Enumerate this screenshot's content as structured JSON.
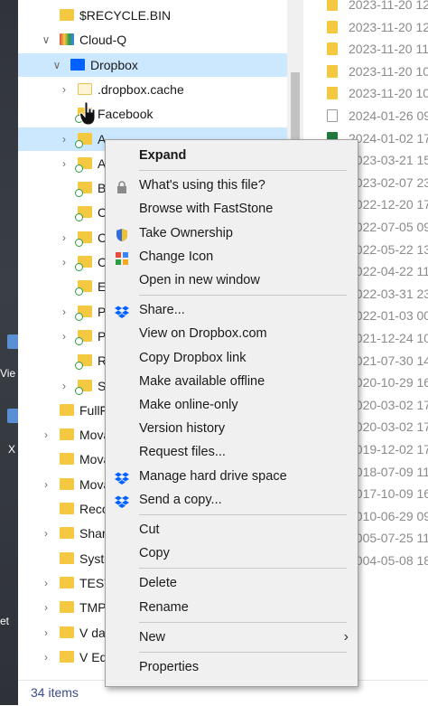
{
  "desktop": {
    "labels": [
      "Vie",
      "X",
      "et"
    ]
  },
  "tree": {
    "rows": [
      {
        "label": "$RECYCLE.BIN",
        "chev": "",
        "indent": 1
      },
      {
        "label": "Cloud-Q",
        "chev": "v",
        "indent": 1
      },
      {
        "label": "Dropbox",
        "chev": "v",
        "indent": 2
      },
      {
        "label": ".dropbox.cache",
        "chev": ">",
        "indent": 3
      },
      {
        "label": "Facebook",
        "chev": "",
        "indent": 3
      },
      {
        "label": "A",
        "chev": ">",
        "indent": 3
      },
      {
        "label": "A",
        "chev": ">",
        "indent": 3
      },
      {
        "label": "Ba",
        "chev": "",
        "indent": 3
      },
      {
        "label": "Ca",
        "chev": "",
        "indent": 3
      },
      {
        "label": "Ca",
        "chev": ">",
        "indent": 3
      },
      {
        "label": "Ca",
        "chev": ">",
        "indent": 3
      },
      {
        "label": "EV",
        "chev": "",
        "indent": 3
      },
      {
        "label": "PC",
        "chev": ">",
        "indent": 3
      },
      {
        "label": "Pr",
        "chev": ">",
        "indent": 3
      },
      {
        "label": "R-",
        "chev": "",
        "indent": 3
      },
      {
        "label": "So",
        "chev": ">",
        "indent": 3
      },
      {
        "label": "FullF",
        "chev": "",
        "indent": 1
      },
      {
        "label": "Mova",
        "chev": ">",
        "indent": 1
      },
      {
        "label": "Mova",
        "chev": "",
        "indent": 1
      },
      {
        "label": "Mova",
        "chev": ">",
        "indent": 1
      },
      {
        "label": "Reco",
        "chev": "",
        "indent": 1
      },
      {
        "label": "Share",
        "chev": ">",
        "indent": 1
      },
      {
        "label": "Syste",
        "chev": "",
        "indent": 1
      },
      {
        "label": "TEST",
        "chev": ">",
        "indent": 1
      },
      {
        "label": "TMP",
        "chev": ">",
        "indent": 1
      },
      {
        "label": "V da",
        "chev": ">",
        "indent": 1
      },
      {
        "label": "V Edi",
        "chev": ">",
        "indent": 1
      }
    ]
  },
  "details": {
    "dates": [
      "2023-11-20 12",
      "2023-11-20 12",
      "2023-11-20 11",
      "2023-11-20 10",
      "2023-11-20 10",
      "2024-01-26 09",
      "2024-01-02 17",
      "2023-03-21 15",
      "2023-02-07 23",
      "2022-12-20 17",
      "2022-07-05 09",
      "2022-05-22 13",
      "2022-04-22 11",
      "2022-03-31 23",
      "2022-01-03 00",
      "2021-12-24 10",
      "2021-07-30 14",
      "2020-10-29 16",
      "2020-03-02 17",
      "2020-03-02 17",
      "2019-12-02 17",
      "2018-07-09 11",
      "2017-10-09 16",
      "2010-06-29 09",
      "2005-07-25 11",
      "2004-05-08 18"
    ]
  },
  "status": {
    "items": "34 items"
  },
  "menu": {
    "items": [
      {
        "label": "Expand",
        "bold": true,
        "icon": ""
      },
      {
        "sep": true
      },
      {
        "label": "What's using this file?",
        "icon": "lock-icon"
      },
      {
        "label": "Browse with FastStone",
        "icon": ""
      },
      {
        "label": "Take Ownership",
        "icon": "shield-icon"
      },
      {
        "label": "Change Icon",
        "icon": "change-icon-icon"
      },
      {
        "label": "Open in new window",
        "icon": ""
      },
      {
        "sep": true
      },
      {
        "label": "Share...",
        "icon": "dropbox-icon"
      },
      {
        "label": "View on Dropbox.com",
        "icon": ""
      },
      {
        "label": "Copy Dropbox link",
        "icon": ""
      },
      {
        "label": "Make available offline",
        "icon": ""
      },
      {
        "label": "Make online-only",
        "icon": ""
      },
      {
        "label": "Version history",
        "icon": ""
      },
      {
        "label": "Request files...",
        "icon": ""
      },
      {
        "label": "Manage hard drive space",
        "icon": "dropbox-icon"
      },
      {
        "label": "Send a copy...",
        "icon": "dropbox-icon"
      },
      {
        "sep": true
      },
      {
        "label": "Cut",
        "icon": ""
      },
      {
        "label": "Copy",
        "icon": ""
      },
      {
        "sep": true
      },
      {
        "label": "Delete",
        "icon": ""
      },
      {
        "label": "Rename",
        "icon": ""
      },
      {
        "sep": true
      },
      {
        "label": "New",
        "icon": "",
        "submenu": true
      },
      {
        "sep": true
      },
      {
        "label": "Properties",
        "icon": ""
      }
    ]
  },
  "colors": {
    "selection": "#cce8ff",
    "hover": "#e5f3ff",
    "folder": "#f5c842",
    "dropbox": "#0061fe",
    "sync_check": "#2e9b45"
  }
}
